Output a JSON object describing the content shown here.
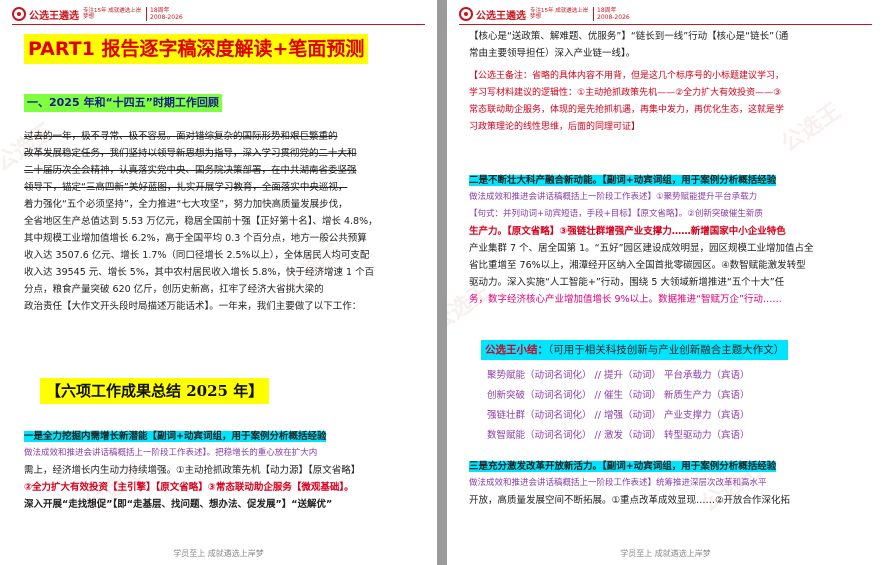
{
  "header": {
    "brand": "公选王遴选",
    "slogan": "专注15年 成就遴选上岸梦想",
    "anniversary": "18周年",
    "years": "2008-2026"
  },
  "footer": "学员至上 成就遴选上岸梦",
  "left": {
    "title": "PART1 报告逐字稿深度解读+笔面预测",
    "section1": "一、2025 年和“十四五”时期工作回顾",
    "p1_lines": [
      "过去的一年，极不寻常、极不容易。面对错综复杂的国际形势和艰巨繁重的",
      "改革发展稳定任务，我们坚持以领导新思想为指导，深入学习贯彻党的二十大和",
      "二十届历次全会精神，认真落实党中央、国务院决策部署，在中共湖南省委坚强",
      "领导下，锚定“三高四新”美好蓝图，扎实开展学习教育，全面落实中央巡视，",
      "着力强化“五个必须坚持”，全力推进“七大攻坚”，努力加快高质量发展步伐，",
      "全省地区生产总值达到 5.53 万亿元，稳居全国前十强【正好第十名】、增长 4.8%，",
      "其中规模工业增加值增长 6.2%，高于全国平均 0.3 个百分点，地方一般公共预算",
      "收入达 3507.6 亿元、增长 1.7%（同口径增长 2.5%以上），全体居民人均可支配",
      "收入达 39545 元、增长 5%，其中农村居民收入增长 5.8%，快于经济增速 1 个百",
      "分点，粮食产量突破 620 亿斤，创历史新高，扛牢了经济大省挑大梁的",
      "政治责任【大作文开头段时局描述万能话术】。一年来，我们主要做了以下工作："
    ],
    "six_title": "【六项工作成果总结 2025 年】",
    "p2_lines": [
      "一是全力挖掘内需增长新潜能【副词+动宾词组，用于案例分析概括经验",
      "做法成效和推进会讲话稿概括上一阶段工作表述】。把稳增长的重心放在扩大内",
      "需上，经济增长内生动力持续增强。①主动抢抓政策先机【动力源】【原文省略】",
      "②全力扩大有效投资【主引擎】【原文省略】③常态联动助企服务【微观基础】。",
      "深入开展“走找想促”【即“走基层、找问题、想办法、促发展”】“送解优”"
    ]
  },
  "right": {
    "p1_lines": [
      "【核心是“送政策、解难题、优服务”】“链长到一线”行动【核心是“链长”（通",
      "常由主要领导担任）深入产业链一线】。"
    ],
    "note_lines": [
      "【公选王备注：省略的具体内容不用背，但是这几个标序号的小标题建议学习，",
      "学习写材料建议的逻辑性：①主动抢抓政策先机——②全力扩大有效投资——③",
      "常态联动助企服务，体现的是先抢抓机遇，再集中发力，再优化生态，这就是学",
      "习政策理论的线性思维，后面的同理可证】"
    ],
    "p2_lines": [
      "二是不断壮大科产融合新动能。【副词+动宾词组，用于案例分析概括经验",
      "做法成效和推进会讲话稿概括上一阶段工作表述】①聚势赋能提升平台承载力",
      "【句式：并列动词+动宾短语，手段+目标】【原文省略】。②创新突破催生新质",
      "生产力。【原文省略】③强链壮群增强产业支撑力……新增国家中小企业特色",
      "产业集群 7 个、居全国第 1。“五好”园区建设成效明显，园区规模工业增加值占全",
      "省比重增至 76%以上，湘潭经开区纳入全国首批零碳园区。④数智赋能激发转型",
      "驱动力。深入实施“人工智能+”行动，围绕 5 大领域新增推进“五个十大”任",
      "务，数字经济核心产业增加值增长 9%以上。数据推进“智赋万企”行动……"
    ],
    "summary_label": "公选王小结：",
    "summary_text": "（可用于相关科技创新与产业创新融合主题大作文）",
    "vocab_rows": [
      [
        "聚势赋能（动词名词化）",
        "//",
        "提升（动词）",
        "平台承载力（宾语）"
      ],
      [
        "创新突破（动词名词化）",
        "//",
        "催生（动词）",
        "新质生产力（宾语）"
      ],
      [
        "强链壮群（动词名词化）",
        "//",
        "增强（动词）",
        "产业支撑力（宾语）"
      ],
      [
        "数智赋能（动词名词化）",
        "//",
        "激发（动词）",
        "转型驱动力（宾语）"
      ]
    ],
    "p3_lines": [
      "三是充分激发改革开放新活力。【副词+动宾词组，用于案例分析概括经验",
      "做法成效和推进会讲话稿概括上一阶段工作表述】统筹推进深层次改革和高水平",
      "开放，高质量发展空间不断拓展。①重点改革成效显现……②开放合作深化拓"
    ]
  },
  "colors": {
    "accent_red": "#d6001c",
    "highlight_yellow": "#ffff00",
    "highlight_cyan": "#00e5ff",
    "highlight_green": "#7fff3f",
    "note_purple": "#8a3ea8"
  }
}
